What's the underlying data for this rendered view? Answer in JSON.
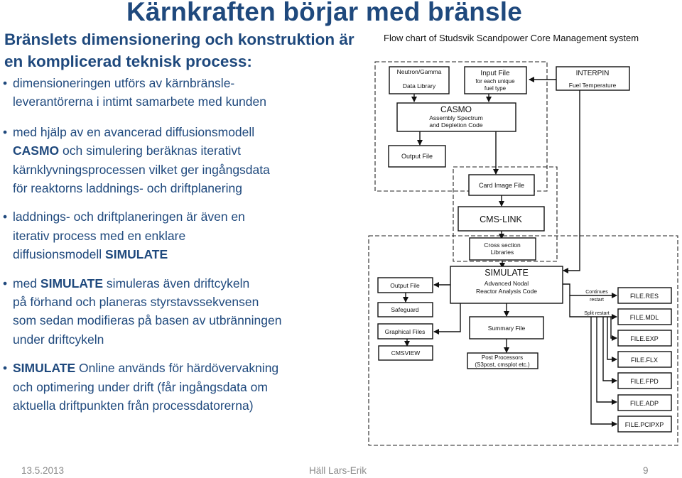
{
  "slide": {
    "title": "Kärnkraften börjar med bränsle",
    "subtitle_line1": "Bränslets dimensionering och konstruktion är",
    "subtitle_line2": "en komplicerad teknisk process:",
    "bullets": [
      {
        "pre": "",
        "bold": "",
        "text": "dimensioneringen utförs av kärnbränsle-\nleverantörerna i intimt samarbete med kunden"
      },
      {
        "pre": "med hjälp av en avancerad diffusionsmodell\n",
        "bold": "CASMO",
        "text": " och simulering beräknas iterativt\nkärnklyvningsprocessen vilket ger ingångsdata\nför reaktorns laddnings- och driftplanering"
      },
      {
        "pre": "laddnings- och driftplaneringen är även en\niterativ process med en enklare\ndiffusionsmodell ",
        "bold": "SIMULATE",
        "text": ""
      },
      {
        "pre": "med ",
        "bold": "SIMULATE",
        "text": " simuleras även driftcykeln\npå förhand och planeras styrstavssekvensen\nsom sedan modifieras på basen av utbränningen\nunder driftcykeln"
      },
      {
        "pre": "",
        "bold": "SIMULATE",
        "text": " Online används för  härdövervakning\noch optimering under drift (får ingångsdata  om\naktuella driftpunkten från processdatorerna)"
      }
    ],
    "bullet_glyph": "•"
  },
  "flowchart": {
    "title": "Flow chart of Studsvik Scandpower Core Management system",
    "boxes": {
      "neutron": [
        "Neutron/Gamma",
        "Data Library"
      ],
      "input": [
        "Input File",
        "for each unique",
        "fuel type"
      ],
      "interpin": [
        "INTERPIN",
        "Fuel Temperature"
      ],
      "casmo": [
        "CASMO",
        "Assembly Spectrum",
        "and Depletion Code"
      ],
      "casmo_out": [
        "Output File"
      ],
      "card": [
        "Card Image File"
      ],
      "cmslink": [
        "CMS-LINK"
      ],
      "xsec": [
        "Cross section",
        "Libraries"
      ],
      "simulate": [
        "SIMULATE",
        "Advanced Nodal",
        "Reactor Analysis Code"
      ],
      "sim_out": [
        "Output File"
      ],
      "safeguard": [
        "Safeguard"
      ],
      "graphical": [
        "Graphical Files"
      ],
      "cmsview": [
        "CMSVIEW"
      ],
      "summary": [
        "Summary File"
      ],
      "post": [
        "Post Processors",
        "(S3post, cmsplot etc.)"
      ],
      "files": [
        "FILE.RES",
        "FILE.MDL",
        "FILE.EXP",
        "FILE.FLX",
        "FILE.FPD",
        "FILE.ADP",
        "FILE.PCIPXP"
      ]
    },
    "labels": {
      "continues": "Continues",
      "restart": "restart",
      "split": "Split restart"
    }
  },
  "footer": {
    "date": "13.5.2013",
    "author": "Häll Lars-Erik",
    "page": "9"
  }
}
